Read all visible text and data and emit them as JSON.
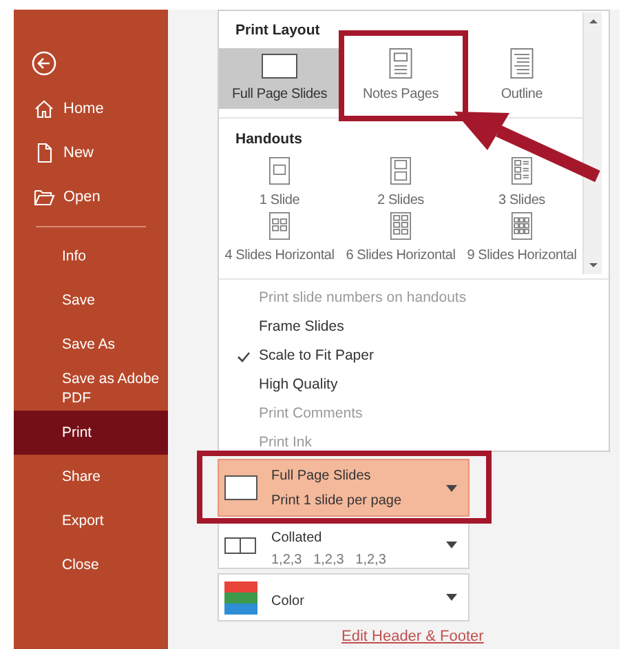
{
  "sidebar": {
    "top_items": [
      {
        "label": "Home",
        "kind": "home"
      },
      {
        "label": "New",
        "kind": "document"
      },
      {
        "label": "Open",
        "kind": "folder"
      }
    ],
    "items": [
      {
        "label": "Info",
        "selected": false
      },
      {
        "label": "Save",
        "selected": false
      },
      {
        "label": "Save As",
        "selected": false
      },
      {
        "label": "Save as Adobe PDF",
        "selected": false
      },
      {
        "label": "Print",
        "selected": true
      },
      {
        "label": "Share",
        "selected": false
      },
      {
        "label": "Export",
        "selected": false
      },
      {
        "label": "Close",
        "selected": false
      }
    ]
  },
  "layout_menu": {
    "print_layout": {
      "heading": "Print Layout",
      "options": [
        {
          "label": "Full Page Slides",
          "kind": "full",
          "selected": true
        },
        {
          "label": "Notes Pages",
          "kind": "notes",
          "selected": false
        },
        {
          "label": "Outline",
          "kind": "outline",
          "selected": false
        }
      ]
    },
    "handouts": {
      "heading": "Handouts",
      "options": [
        {
          "label": "1 Slide",
          "kind": "one",
          "selected": false
        },
        {
          "label": "2 Slides",
          "kind": "two",
          "selected": false
        },
        {
          "label": "3 Slides",
          "kind": "three",
          "selected": false
        },
        {
          "label": "4 Slides Horizontal",
          "kind": "four",
          "selected": false
        },
        {
          "label": "6 Slides Horizontal",
          "kind": "six",
          "selected": false
        },
        {
          "label": "9 Slides Horizontal",
          "kind": "nine",
          "selected": false
        }
      ]
    },
    "options": [
      {
        "label": "Print slide numbers on handouts",
        "checked": false,
        "disabled": true
      },
      {
        "label": "Frame Slides",
        "checked": false,
        "disabled": false
      },
      {
        "label": "Scale to Fit Paper",
        "checked": true,
        "disabled": false
      },
      {
        "label": "High Quality",
        "checked": false,
        "disabled": false
      },
      {
        "label": "Print Comments",
        "checked": false,
        "disabled": true
      },
      {
        "label": "Print Ink",
        "checked": false,
        "disabled": true
      }
    ]
  },
  "settings": [
    {
      "kind": "layout",
      "title": "Full Page Slides",
      "subtitle": "Print 1 slide per page",
      "active": true
    },
    {
      "kind": "collate",
      "title": "Collated",
      "subtitle": "1,2,3   1,2,3   1,2,3",
      "active": false
    },
    {
      "kind": "color",
      "title": "Color",
      "active": false
    }
  ],
  "link": "Edit Header & Footer"
}
